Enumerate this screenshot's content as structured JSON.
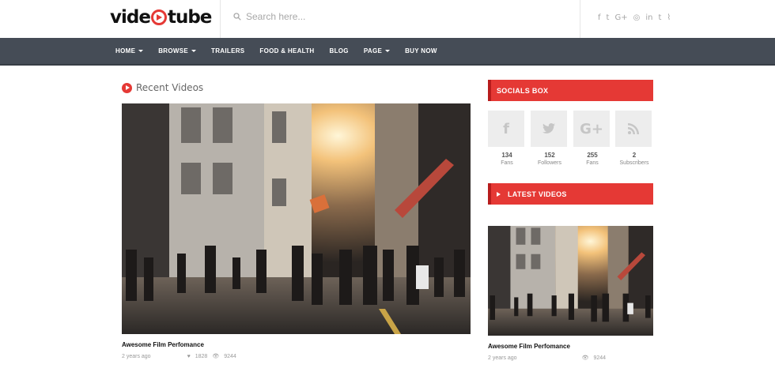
{
  "logo": {
    "part1": "vide",
    "part2": "tube"
  },
  "search": {
    "placeholder": "Search here..."
  },
  "header_social": [
    "f",
    "t",
    "G+",
    "◎",
    "in",
    "t",
    "⌇"
  ],
  "nav": [
    {
      "label": "HOME",
      "dropdown": true
    },
    {
      "label": "BROWSE",
      "dropdown": true
    },
    {
      "label": "TRAILERS",
      "dropdown": false
    },
    {
      "label": "FOOD & HEALTH",
      "dropdown": false
    },
    {
      "label": "BLOG",
      "dropdown": false
    },
    {
      "label": "PAGE",
      "dropdown": true
    },
    {
      "label": "BUY NOW",
      "dropdown": false
    }
  ],
  "recent": {
    "title": "Recent Videos",
    "video": {
      "title": "Awesome Film Perfomance",
      "age": "2 years ago",
      "likes": "1828",
      "views": "9244"
    }
  },
  "socials": {
    "title": "SOCIALS BOX",
    "items": [
      {
        "icon": "f",
        "count": "134",
        "label": "Fans"
      },
      {
        "icon": "t",
        "count": "152",
        "label": "Followers"
      },
      {
        "icon": "G+",
        "count": "255",
        "label": "Fans"
      },
      {
        "icon": "rss",
        "count": "2",
        "label": "Subscribers"
      }
    ]
  },
  "latest": {
    "title": "LATEST VIDEOS",
    "video": {
      "title": "Awesome Film Perfomance",
      "age": "2 years ago",
      "views": "9244"
    }
  },
  "colors": {
    "accent": "#e53935",
    "nav": "#454c56"
  }
}
